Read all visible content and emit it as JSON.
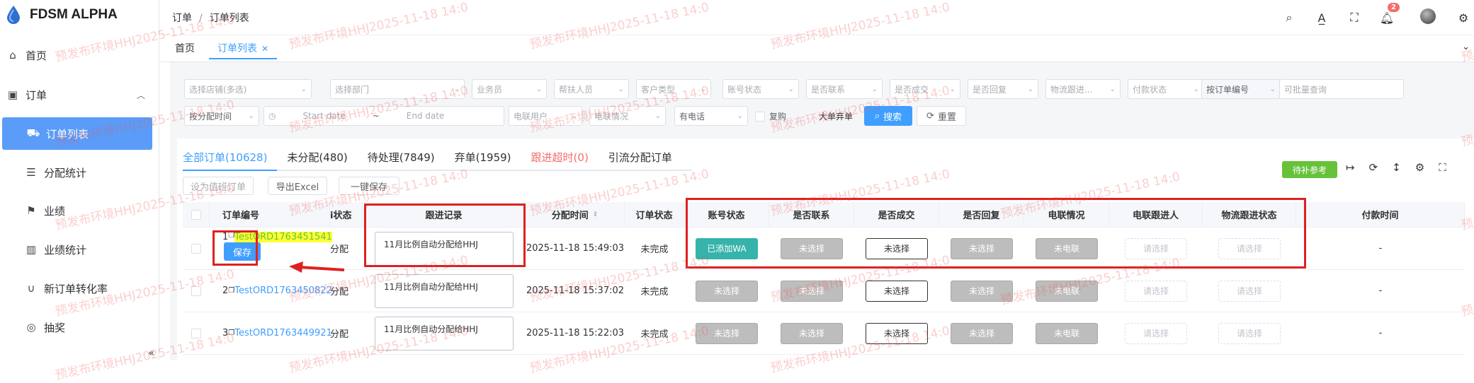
{
  "app": {
    "title": "FDSM ALPHA"
  },
  "sidebar": {
    "items": [
      {
        "label": "首页",
        "icon": "home-icon"
      },
      {
        "label": "订单",
        "icon": "briefcase-icon"
      },
      {
        "label": "订单列表",
        "icon": "cart-icon"
      },
      {
        "label": "分配统计",
        "icon": "database-icon"
      },
      {
        "label": "业绩",
        "icon": "flag-icon"
      },
      {
        "label": "业绩统计",
        "icon": "bar-chart-icon"
      },
      {
        "label": "新订单转化率",
        "icon": "magnet-icon"
      },
      {
        "label": "抽奖",
        "icon": "medal-icon"
      }
    ]
  },
  "header": {
    "breadcrumb": [
      "订单",
      "订单列表"
    ],
    "badge_count": "2"
  },
  "tags": {
    "home": "首页",
    "current": "订单列表"
  },
  "filters": {
    "store": "选择店铺(多选)",
    "dept": "选择部门",
    "salesman": "业务员",
    "helper": "帮扶人员",
    "customer_type": "客户类型",
    "account_status": "账号状态",
    "contacted": "是否联系",
    "deal": "是否成交",
    "replied": "是否回复",
    "logistics": "物流跟进...",
    "payment": "付款状态",
    "order_no_type": "按订单编号",
    "batch_query": "可批量查询",
    "time_type": "按分配时间",
    "start_date": "Start date",
    "range_sep": "~",
    "end_date": "End date",
    "ec_user": "电联用户",
    "ec_status": "电联情况",
    "has_phone": "有电话",
    "repurchase": "复购",
    "big_abandon": "大单弃单",
    "search": "搜索",
    "reset": "重置"
  },
  "tabs": [
    {
      "label": "全部订单(10628)"
    },
    {
      "label": "未分配(480)"
    },
    {
      "label": "待处理(7849)"
    },
    {
      "label": "弃单(1959)"
    },
    {
      "label": "跟进超时(0)"
    },
    {
      "label": "引流分配订单"
    }
  ],
  "actions": {
    "set_duty": "设为值班订单",
    "export": "导出Excel",
    "one_click_save": "一键保存",
    "pending_ref": "待补参考"
  },
  "table": {
    "headers": {
      "order_no": "订单编号",
      "status_partial": "i状态",
      "follow": "跟进记录",
      "assign_time": "分配时间",
      "order_status": "订单状态",
      "account_status": "账号状态",
      "contacted": "是否联系",
      "deal": "是否成交",
      "replied": "是否回复",
      "ec_status": "电联情况",
      "ec_follower": "电联跟进人",
      "logistics": "物流跟进状态",
      "pay_time": "付款时间"
    },
    "save_label": "保存",
    "rows": [
      {
        "idx": "1",
        "order": "TestORD1763451541",
        "alloc": "分配",
        "note": "11月比例自动分配给HHJ",
        "time": "2025-11-18 15:49:03",
        "status": "未完成",
        "account": "已添加WA",
        "contacted": "未选择",
        "deal": "未选择",
        "replied": "未选择",
        "ec": "未电联",
        "ec_person": "请选择",
        "logi": "请选择",
        "pay": "-"
      },
      {
        "idx": "2",
        "order": "TestORD1763450822",
        "alloc": "分配",
        "note": "11月比例自动分配给HHJ",
        "time": "2025-11-18 15:37:02",
        "status": "未完成",
        "account": "未选择",
        "contacted": "未选择",
        "deal": "未选择",
        "replied": "未选择",
        "ec": "未电联",
        "ec_person": "请选择",
        "logi": "请选择",
        "pay": "-"
      },
      {
        "idx": "3",
        "order": "TestORD1763449921",
        "alloc": "分配",
        "note": "11月比例自动分配给HHJ",
        "time": "2025-11-18 15:22:03",
        "status": "未完成",
        "account": "未选择",
        "contacted": "未选择",
        "deal": "未选择",
        "replied": "未选择",
        "ec": "未电联",
        "ec_person": "请选择",
        "logi": "请选择",
        "pay": "-"
      }
    ]
  },
  "watermark": "预发布环境HHJ2025-11-18 14:0",
  "colors": {
    "primary": "#409eff",
    "annotation_red": "#e02020",
    "success": "#67c23a",
    "teal": "#36b3aa"
  }
}
